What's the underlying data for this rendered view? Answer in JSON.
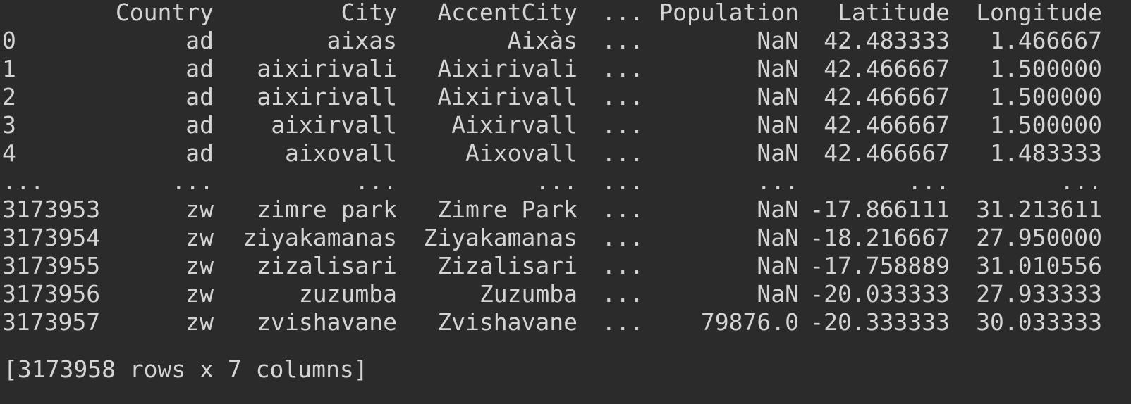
{
  "columns": [
    "Country",
    "City",
    "AccentCity",
    "...",
    "Population",
    "Latitude",
    "Longitude"
  ],
  "rows": [
    {
      "index": "0",
      "Country": "ad",
      "City": "aixas",
      "AccentCity": "Aixàs",
      "ellipsis": "...",
      "Population": "NaN",
      "Latitude": "42.483333",
      "Longitude": "1.466667"
    },
    {
      "index": "1",
      "Country": "ad",
      "City": "aixirivali",
      "AccentCity": "Aixirivali",
      "ellipsis": "...",
      "Population": "NaN",
      "Latitude": "42.466667",
      "Longitude": "1.500000"
    },
    {
      "index": "2",
      "Country": "ad",
      "City": "aixirivall",
      "AccentCity": "Aixirivall",
      "ellipsis": "...",
      "Population": "NaN",
      "Latitude": "42.466667",
      "Longitude": "1.500000"
    },
    {
      "index": "3",
      "Country": "ad",
      "City": "aixirvall",
      "AccentCity": "Aixirvall",
      "ellipsis": "...",
      "Population": "NaN",
      "Latitude": "42.466667",
      "Longitude": "1.500000"
    },
    {
      "index": "4",
      "Country": "ad",
      "City": "aixovall",
      "AccentCity": "Aixovall",
      "ellipsis": "...",
      "Population": "NaN",
      "Latitude": "42.466667",
      "Longitude": "1.483333"
    },
    {
      "index": "...",
      "Country": "...",
      "City": "...",
      "AccentCity": "...",
      "ellipsis": "...",
      "Population": "...",
      "Latitude": "...",
      "Longitude": "..."
    },
    {
      "index": "3173953",
      "Country": "zw",
      "City": "zimre park",
      "AccentCity": "Zimre Park",
      "ellipsis": "...",
      "Population": "NaN",
      "Latitude": "-17.866111",
      "Longitude": "31.213611"
    },
    {
      "index": "3173954",
      "Country": "zw",
      "City": "ziyakamanas",
      "AccentCity": "Ziyakamanas",
      "ellipsis": "...",
      "Population": "NaN",
      "Latitude": "-18.216667",
      "Longitude": "27.950000"
    },
    {
      "index": "3173955",
      "Country": "zw",
      "City": "zizalisari",
      "AccentCity": "Zizalisari",
      "ellipsis": "...",
      "Population": "NaN",
      "Latitude": "-17.758889",
      "Longitude": "31.010556"
    },
    {
      "index": "3173956",
      "Country": "zw",
      "City": "zuzumba",
      "AccentCity": "Zuzumba",
      "ellipsis": "...",
      "Population": "NaN",
      "Latitude": "-20.033333",
      "Longitude": "27.933333"
    },
    {
      "index": "3173957",
      "Country": "zw",
      "City": "zvishavane",
      "AccentCity": "Zvishavane",
      "ellipsis": "...",
      "Population": "79876.0",
      "Latitude": "-20.333333",
      "Longitude": "30.033333"
    }
  ],
  "summary": "[3173958 rows x 7 columns]",
  "colors": {
    "background": "#2b2b2b",
    "text": "#d4d4d4"
  }
}
